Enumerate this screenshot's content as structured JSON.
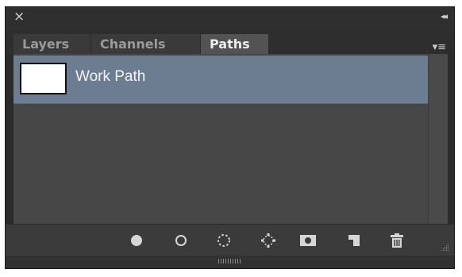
{
  "titlebar": {
    "close_glyph": "×",
    "collapse_glyph": "◂◂"
  },
  "tabs": [
    {
      "label": "Layers",
      "active": false
    },
    {
      "label": "Channels",
      "active": false
    },
    {
      "label": "Paths",
      "active": true
    }
  ],
  "panel_menu": {
    "glyph": "▾≡"
  },
  "paths": [
    {
      "name": "Work Path",
      "selected": true
    }
  ],
  "footer_buttons": [
    {
      "icon": "fill-path-icon",
      "tooltip": ""
    },
    {
      "icon": "stroke-path-icon",
      "tooltip": ""
    },
    {
      "icon": "load-selection-icon",
      "tooltip": ""
    },
    {
      "icon": "make-work-path-icon",
      "tooltip": ""
    },
    {
      "icon": "add-mask-icon",
      "tooltip": ""
    },
    {
      "icon": "new-path-icon",
      "tooltip": ""
    },
    {
      "icon": "delete-path-icon",
      "tooltip": ""
    }
  ],
  "colors": {
    "panel_bg": "#474747",
    "selected_row": "#6c7d92",
    "active_tab": "#535353",
    "icon": "#d0d0d0"
  }
}
